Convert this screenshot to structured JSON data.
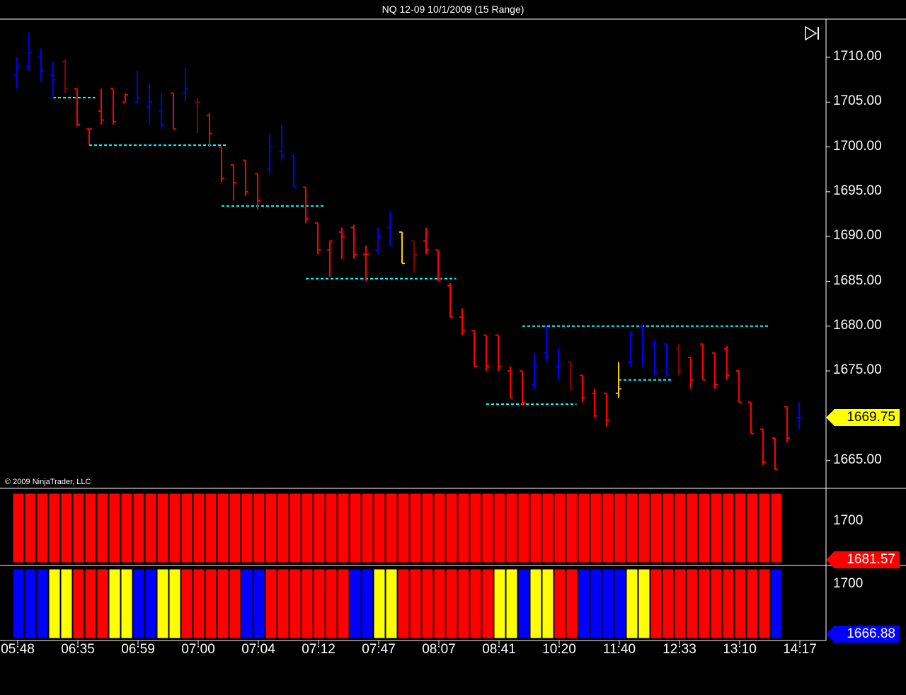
{
  "window": {
    "title": "NQ 12-09  10/1/2009 (15 Range)"
  },
  "copyright": "© 2009 NinjaTrader, LLC",
  "colors": {
    "background": "#000000",
    "up": "#0000ff",
    "down": "#ff0000",
    "dark": "#8b0000",
    "neutral": "#ffcc00",
    "level": "#00ffff",
    "panel_red": "#ff0000",
    "panel_blue": "#0000ff",
    "panel_yellow": "#ffff00"
  },
  "price_axis": {
    "labels": [
      "1710.00",
      "1705.00",
      "1700.00",
      "1695.00",
      "1690.00",
      "1685.00",
      "1680.00",
      "1675.00",
      "1665.00"
    ],
    "current_price": "1669.75"
  },
  "panel1": {
    "axis_label": "1700",
    "value": "1681.57"
  },
  "panel2": {
    "axis_label": "1700",
    "value": "1666.88"
  },
  "time_axis": {
    "labels": [
      "05:48",
      "06:35",
      "06:59",
      "07:00",
      "07:04",
      "07:12",
      "07:47",
      "08:07",
      "08:41",
      "10:20",
      "11:40",
      "12:33",
      "13:10",
      "14:17"
    ]
  },
  "chart_data": {
    "type": "ohlc",
    "instrument": "NQ 12-09",
    "date": "10/1/2009",
    "bar_type": "15 Range",
    "ylim": [
      1662.5,
      1714.0
    ],
    "bars": [
      {
        "o": 1708,
        "h": 1710,
        "l": 1706.5,
        "c": 1709,
        "col": "up"
      },
      {
        "o": 1709,
        "h": 1712.8,
        "l": 1708.5,
        "c": 1710.5,
        "col": "up"
      },
      {
        "o": 1710,
        "h": 1711,
        "l": 1707.3,
        "c": 1708.5,
        "col": "up"
      },
      {
        "o": 1708,
        "h": 1709.5,
        "l": 1705.5,
        "c": 1707.5,
        "col": "up"
      },
      {
        "o": 1709.5,
        "h": 1709.8,
        "l": 1706,
        "c": 1706.5,
        "col": "dark"
      },
      {
        "o": 1706.5,
        "h": 1706.5,
        "l": 1702.3,
        "c": 1702.5,
        "col": "down"
      },
      {
        "o": 1702,
        "h": 1702,
        "l": 1700.3,
        "c": 1702,
        "col": "down"
      },
      {
        "o": 1704,
        "h": 1706.5,
        "l": 1702.5,
        "c": 1703,
        "col": "down"
      },
      {
        "o": 1706.5,
        "h": 1706.5,
        "l": 1702.5,
        "c": 1702.8,
        "col": "down"
      },
      {
        "o": 1705,
        "h": 1706,
        "l": 1705,
        "c": 1705.8,
        "col": "down"
      },
      {
        "o": 1705,
        "h": 1708.5,
        "l": 1705,
        "c": 1705.5,
        "col": "up"
      },
      {
        "o": 1704.5,
        "h": 1707,
        "l": 1702.5,
        "c": 1705,
        "col": "up"
      },
      {
        "o": 1704,
        "h": 1706,
        "l": 1702,
        "c": 1702.5,
        "col": "up"
      },
      {
        "o": 1706,
        "h": 1706,
        "l": 1702,
        "c": 1702,
        "col": "down"
      },
      {
        "o": 1706,
        "h": 1708.8,
        "l": 1705,
        "c": 1706.5,
        "col": "up"
      },
      {
        "o": 1705,
        "h": 1705.5,
        "l": 1701.5,
        "c": 1705,
        "col": "dark"
      },
      {
        "o": 1703.5,
        "h": 1703.8,
        "l": 1700,
        "c": 1701.5,
        "col": "down"
      },
      {
        "o": 1700,
        "h": 1700,
        "l": 1696,
        "c": 1696.5,
        "col": "down"
      },
      {
        "o": 1698,
        "h": 1698,
        "l": 1694,
        "c": 1696,
        "col": "down"
      },
      {
        "o": 1698.5,
        "h": 1698.5,
        "l": 1694.5,
        "c": 1695,
        "col": "down"
      },
      {
        "o": 1697,
        "h": 1697,
        "l": 1693,
        "c": 1694,
        "col": "down"
      },
      {
        "o": 1697.5,
        "h": 1701.5,
        "l": 1697,
        "c": 1700,
        "col": "up"
      },
      {
        "o": 1699.5,
        "h": 1702.5,
        "l": 1698.5,
        "c": 1699,
        "col": "up"
      },
      {
        "o": 1699,
        "h": 1699,
        "l": 1695.5,
        "c": 1695.5,
        "col": "up"
      },
      {
        "o": 1695.5,
        "h": 1695.5,
        "l": 1691.5,
        "c": 1692,
        "col": "down"
      },
      {
        "o": 1691.5,
        "h": 1691.5,
        "l": 1688,
        "c": 1688.5,
        "col": "down"
      },
      {
        "o": 1688.5,
        "h": 1689.5,
        "l": 1685.5,
        "c": 1689.5,
        "col": "down"
      },
      {
        "o": 1690.5,
        "h": 1691,
        "l": 1687.5,
        "c": 1690,
        "col": "down"
      },
      {
        "o": 1691,
        "h": 1691.3,
        "l": 1687.5,
        "c": 1688,
        "col": "down"
      },
      {
        "o": 1688,
        "h": 1689,
        "l": 1685,
        "c": 1688,
        "col": "down"
      },
      {
        "o": 1688.5,
        "h": 1691,
        "l": 1688,
        "c": 1690,
        "col": "up"
      },
      {
        "o": 1691,
        "h": 1692.8,
        "l": 1689,
        "c": 1689,
        "col": "up"
      },
      {
        "o": 1690.5,
        "h": 1690.5,
        "l": 1687,
        "c": 1687,
        "col": "neutral"
      },
      {
        "o": 1689.5,
        "h": 1689.5,
        "l": 1686,
        "c": 1688,
        "col": "dark"
      },
      {
        "o": 1689.5,
        "h": 1691,
        "l": 1688,
        "c": 1688.5,
        "col": "down"
      },
      {
        "o": 1688.5,
        "h": 1688.5,
        "l": 1685,
        "c": 1685.3,
        "col": "down"
      },
      {
        "o": 1684.5,
        "h": 1684.8,
        "l": 1681,
        "c": 1681,
        "col": "down"
      },
      {
        "o": 1681,
        "h": 1682,
        "l": 1679,
        "c": 1679.5,
        "col": "down"
      },
      {
        "o": 1679.5,
        "h": 1679.5,
        "l": 1675.5,
        "c": 1675.5,
        "col": "down"
      },
      {
        "o": 1679,
        "h": 1679,
        "l": 1675,
        "c": 1675.5,
        "col": "down"
      },
      {
        "o": 1679,
        "h": 1679,
        "l": 1675,
        "c": 1675.5,
        "col": "down"
      },
      {
        "o": 1675,
        "h": 1675.5,
        "l": 1672,
        "c": 1672,
        "col": "down"
      },
      {
        "o": 1675,
        "h": 1675,
        "l": 1671.2,
        "c": 1671.5,
        "col": "down"
      },
      {
        "o": 1673.5,
        "h": 1677,
        "l": 1673,
        "c": 1675.5,
        "col": "up"
      },
      {
        "o": 1677,
        "h": 1680,
        "l": 1676,
        "c": 1676.5,
        "col": "up"
      },
      {
        "o": 1675.5,
        "h": 1677.5,
        "l": 1674,
        "c": 1676,
        "col": "up"
      },
      {
        "o": 1676,
        "h": 1676,
        "l": 1673,
        "c": 1673,
        "col": "dark"
      },
      {
        "o": 1674.5,
        "h": 1674.5,
        "l": 1671.5,
        "c": 1672,
        "col": "down"
      },
      {
        "o": 1672.5,
        "h": 1673,
        "l": 1669.8,
        "c": 1670,
        "col": "down"
      },
      {
        "o": 1672.5,
        "h": 1672.5,
        "l": 1668.8,
        "c": 1669.5,
        "col": "down"
      },
      {
        "o": 1672.5,
        "h": 1676,
        "l": 1672,
        "c": 1673,
        "col": "neutral"
      },
      {
        "o": 1676,
        "h": 1679.5,
        "l": 1675.5,
        "c": 1679,
        "col": "up"
      },
      {
        "o": 1680,
        "h": 1680,
        "l": 1675.5,
        "c": 1676.5,
        "col": "up"
      },
      {
        "o": 1678,
        "h": 1678.5,
        "l": 1674.5,
        "c": 1674.8,
        "col": "up"
      },
      {
        "o": 1678,
        "h": 1678,
        "l": 1674.5,
        "c": 1674.5,
        "col": "up"
      },
      {
        "o": 1677.5,
        "h": 1678,
        "l": 1674.5,
        "c": 1675,
        "col": "dark"
      },
      {
        "o": 1676.5,
        "h": 1676.5,
        "l": 1673,
        "c": 1674,
        "col": "down"
      },
      {
        "o": 1678,
        "h": 1678,
        "l": 1674,
        "c": 1674,
        "col": "down"
      },
      {
        "o": 1677,
        "h": 1677,
        "l": 1673,
        "c": 1673.5,
        "col": "down"
      },
      {
        "o": 1677.5,
        "h": 1677.8,
        "l": 1674,
        "c": 1674.5,
        "col": "down"
      },
      {
        "o": 1675,
        "h": 1675,
        "l": 1671.5,
        "c": 1671.5,
        "col": "down"
      },
      {
        "o": 1671.5,
        "h": 1671.5,
        "l": 1668,
        "c": 1668,
        "col": "down"
      },
      {
        "o": 1668.5,
        "h": 1668.5,
        "l": 1664.5,
        "c": 1664.8,
        "col": "down"
      },
      {
        "o": 1667.5,
        "h": 1667.5,
        "l": 1664,
        "c": 1664,
        "col": "down"
      },
      {
        "o": 1671,
        "h": 1671,
        "l": 1667,
        "c": 1667.5,
        "col": "down"
      },
      {
        "o": 1669.8,
        "h": 1671.5,
        "l": 1668.5,
        "c": 1669.75,
        "col": "up"
      }
    ],
    "levels": [
      {
        "price": 1705.5,
        "from": 3,
        "to": 6.5
      },
      {
        "price": 1700.2,
        "from": 6,
        "to": 17.5
      },
      {
        "price": 1693.4,
        "from": 17,
        "to": 25.5
      },
      {
        "price": 1685.3,
        "from": 24,
        "to": 36.5
      },
      {
        "price": 1680,
        "from": 42,
        "to": 62.5
      },
      {
        "price": 1674,
        "from": 50,
        "to": 54.5
      },
      {
        "price": 1671.3,
        "from": 39,
        "to": 46.5
      }
    ],
    "panel1_colors": [
      "r",
      "r",
      "r",
      "r",
      "r",
      "r",
      "r",
      "r",
      "r",
      "r",
      "r",
      "r",
      "r",
      "r",
      "r",
      "r",
      "r",
      "r",
      "r",
      "r",
      "r",
      "r",
      "r",
      "r",
      "r",
      "r",
      "r",
      "r",
      "r",
      "r",
      "r",
      "r",
      "r",
      "r",
      "r",
      "r",
      "r",
      "r",
      "r",
      "r",
      "r",
      "r",
      "r",
      "r",
      "r",
      "r",
      "r",
      "r",
      "r",
      "r",
      "r",
      "r",
      "r",
      "r",
      "r",
      "r",
      "r",
      "r",
      "r",
      "r",
      "r",
      "r",
      "r",
      "r"
    ],
    "panel2_colors": [
      "b",
      "b",
      "b",
      "y",
      "y",
      "r",
      "r",
      "r",
      "y",
      "y",
      "b",
      "b",
      "y",
      "y",
      "r",
      "r",
      "r",
      "r",
      "r",
      "b",
      "b",
      "r",
      "r",
      "r",
      "r",
      "r",
      "r",
      "r",
      "b",
      "b",
      "y",
      "y",
      "r",
      "r",
      "r",
      "r",
      "r",
      "r",
      "r",
      "r",
      "y",
      "y",
      "b",
      "y",
      "y",
      "r",
      "r",
      "b",
      "b",
      "b",
      "b",
      "y",
      "y",
      "r",
      "r",
      "r",
      "r",
      "r",
      "r",
      "r",
      "r",
      "r",
      "r",
      "b"
    ]
  }
}
